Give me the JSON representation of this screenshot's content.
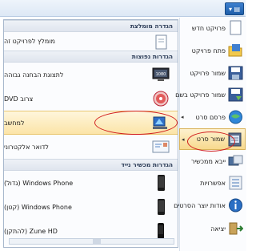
{
  "app": {
    "menu_button_label": "▾ ▤"
  },
  "submenu": {
    "sections": [
      {
        "header": "הגדרה מומלצת",
        "items": [
          {
            "label": "מומלץ לפרויקט זה",
            "icon": "project-icon"
          }
        ]
      },
      {
        "header": "הגדרות נפוצות",
        "items": [
          {
            "label": "לתצוגת הבחנה גבוהה",
            "icon": "monitor-hd-icon"
          },
          {
            "label": "צרוב DVD",
            "icon": "dvd-icon"
          },
          {
            "label": "למחשב",
            "icon": "computer-icon"
          },
          {
            "label": "לדואר אלקטרוני",
            "icon": "email-icon"
          }
        ]
      },
      {
        "header": "הגדרות מכשיר נייד",
        "items": [
          {
            "label": "Windows Phone (גדול)",
            "icon": "phone-icon"
          },
          {
            "label": "Windows Phone (קטן)",
            "icon": "phone-icon"
          },
          {
            "label": "Zune HD (להתקן)",
            "icon": "zune-icon"
          }
        ]
      }
    ]
  },
  "main_menu": {
    "items": [
      {
        "label": "פרויקט חדש",
        "icon": "new-project-icon"
      },
      {
        "label": "פתח פרויקט",
        "icon": "open-project-icon"
      },
      {
        "label": "שמור פרויקט",
        "icon": "save-project-icon"
      },
      {
        "label": "שמור פרויקט בשם",
        "icon": "save-as-icon"
      },
      {
        "label": "פרסם סרט",
        "icon": "publish-icon"
      },
      {
        "label": "שמור סרט",
        "icon": "save-movie-icon"
      },
      {
        "label": "ייבא ממכשיר",
        "icon": "import-icon"
      },
      {
        "label": "אפשרויות",
        "icon": "options-icon"
      },
      {
        "label": "אודות יוצר הסרטים",
        "icon": "about-icon"
      },
      {
        "label": "יציאה",
        "icon": "exit-icon"
      }
    ]
  },
  "colors": {
    "highlight": "#fbe4a7",
    "annotation": "#d11d1d",
    "accent": "#1f5ea8"
  }
}
